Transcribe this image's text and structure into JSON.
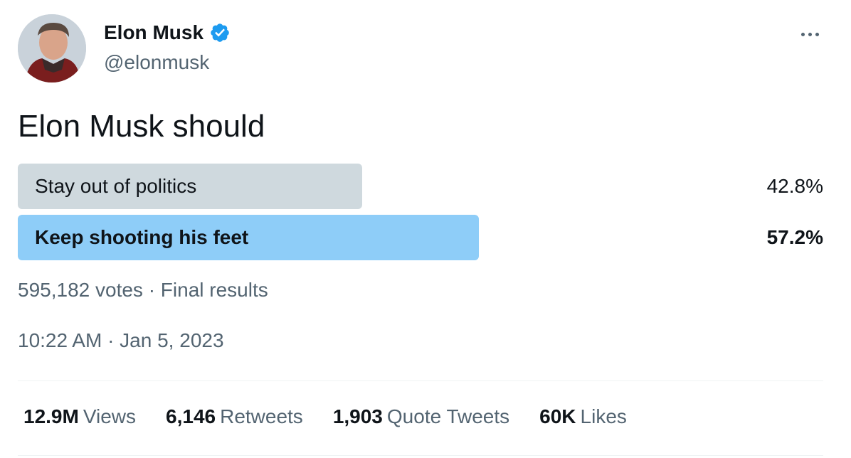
{
  "author": {
    "name": "Elon Musk",
    "handle": "@elonmusk",
    "verified": true
  },
  "tweet": {
    "text": "Elon Musk should"
  },
  "poll": {
    "options": [
      {
        "label": "Stay out of politics",
        "percent_text": "42.8%",
        "percent": 42.8,
        "winner": false,
        "bar_color": "#cfd9de"
      },
      {
        "label": "Keep shooting his feet",
        "percent_text": "57.2%",
        "percent": 57.2,
        "winner": true,
        "bar_color": "#8ecdf8"
      }
    ],
    "meta": "595,182 votes · Final results"
  },
  "timestamp": "10:22 AM · Jan 5, 2023",
  "stats": [
    {
      "value": "12.9M",
      "label": "Views"
    },
    {
      "value": "6,146",
      "label": "Retweets"
    },
    {
      "value": "1,903",
      "label": "Quote Tweets"
    },
    {
      "value": "60K",
      "label": "Likes"
    }
  ],
  "colors": {
    "verified_blue": "#1d9bf0",
    "secondary_text": "#536471",
    "primary_text": "#0f1419"
  },
  "icons": {
    "verified": "verified-badge-icon",
    "more": "more-options-icon"
  }
}
